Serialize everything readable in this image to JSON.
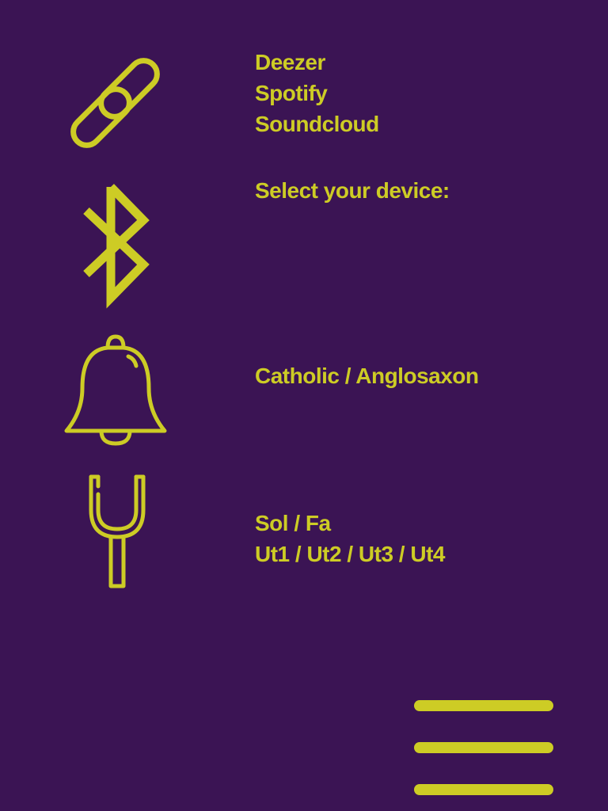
{
  "theme": {
    "background": "#3b1454",
    "accent": "#cdcc25"
  },
  "icons": {
    "link": "link-icon",
    "bluetooth": "bluetooth-icon",
    "bell": "bell-icon",
    "tuning_fork": "tuning-fork-icon",
    "menu": "hamburger-menu-icon"
  },
  "streaming": {
    "services": [
      "Deezer",
      "Spotify",
      "Soundcloud"
    ]
  },
  "bluetooth": {
    "prompt": "Select your device:"
  },
  "bell": {
    "options_label": "Catholic / Anglosaxon"
  },
  "tuning": {
    "clef_label": "Sol / Fa",
    "ut_label": "Ut1 / Ut2 / Ut3 / Ut4"
  }
}
